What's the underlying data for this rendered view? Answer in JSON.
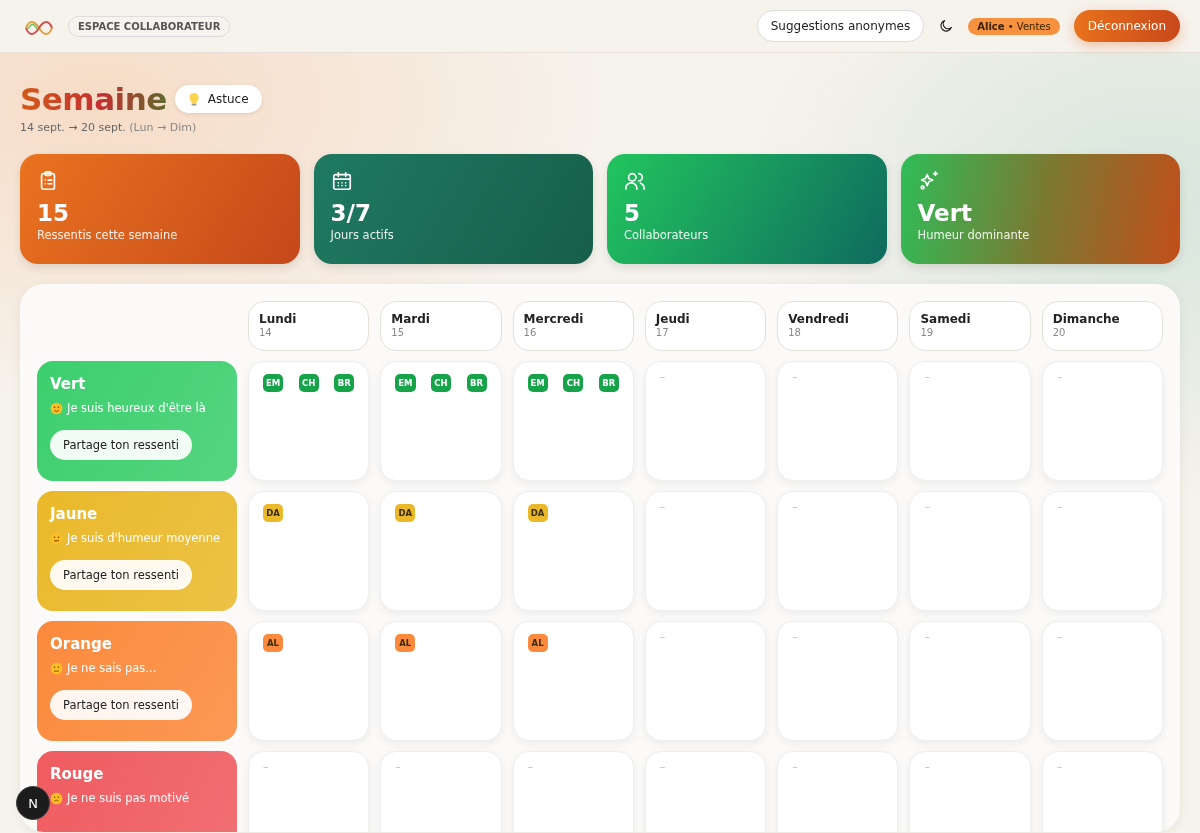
{
  "header": {
    "badge": "ESPACE COLLABORATEUR",
    "suggestions_button": "Suggestions anonymes",
    "user": {
      "name": "Alice",
      "separator": "•",
      "team": "Ventes"
    },
    "logout_button": "Déconnexion"
  },
  "page": {
    "title": "Semaine",
    "tip_button": "Astuce",
    "range": "14 sept. → 20 sept.",
    "range_hint": "(Lun → Dim)"
  },
  "stats": [
    {
      "kind": "clipboard",
      "value": "15",
      "label": "Ressentis cette semaine"
    },
    {
      "kind": "calendar",
      "value": "3/7",
      "label": "Jours actifs"
    },
    {
      "kind": "users",
      "value": "5",
      "label": "Collaborateurs"
    },
    {
      "kind": "sparkles",
      "value": "Vert",
      "label": "Humeur dominante"
    }
  ],
  "days": [
    {
      "name": "Lundi",
      "date": "14"
    },
    {
      "name": "Mardi",
      "date": "15"
    },
    {
      "name": "Mercredi",
      "date": "16"
    },
    {
      "name": "Jeudi",
      "date": "17"
    },
    {
      "name": "Vendredi",
      "date": "18"
    },
    {
      "name": "Samedi",
      "date": "19"
    },
    {
      "name": "Dimanche",
      "date": "20"
    }
  ],
  "moods": [
    {
      "name": "Vert",
      "color": "#3ccf6e",
      "kind": "happy",
      "text": "Je suis heureux d'être là",
      "button": "Partage ton ressenti",
      "cells": [
        {
          "kind": "badges",
          "badges": [
            "EM",
            "CH",
            "BR"
          ]
        },
        {
          "kind": "badges",
          "badges": [
            "EM",
            "CH",
            "BR"
          ]
        },
        {
          "kind": "badges",
          "badges": [
            "EM",
            "CH",
            "BR"
          ]
        },
        {
          "kind": "empty",
          "text": "–"
        },
        {
          "kind": "empty",
          "text": "–"
        },
        {
          "kind": "empty",
          "text": "–"
        },
        {
          "kind": "empty",
          "text": "–"
        }
      ]
    },
    {
      "name": "Jaune",
      "color": "#eab92a",
      "kind": "neutral",
      "text": "Je suis d'humeur moyenne",
      "button": "Partage ton ressenti",
      "cells": [
        {
          "kind": "badges",
          "badges": [
            "DA"
          ]
        },
        {
          "kind": "badges",
          "badges": [
            "DA"
          ]
        },
        {
          "kind": "badges",
          "badges": [
            "DA"
          ]
        },
        {
          "kind": "empty",
          "text": "–"
        },
        {
          "kind": "empty",
          "text": "–"
        },
        {
          "kind": "empty",
          "text": "–"
        },
        {
          "kind": "empty",
          "text": "–"
        }
      ]
    },
    {
      "name": "Orange",
      "color": "#fb8a3c",
      "kind": "unsure",
      "text": "Je ne sais pas...",
      "button": "Partage ton ressenti",
      "cells": [
        {
          "kind": "badges",
          "badges": [
            "AL"
          ]
        },
        {
          "kind": "badges",
          "badges": [
            "AL"
          ]
        },
        {
          "kind": "badges",
          "badges": [
            "AL"
          ]
        },
        {
          "kind": "empty",
          "text": "–"
        },
        {
          "kind": "empty",
          "text": "–"
        },
        {
          "kind": "empty",
          "text": "–"
        },
        {
          "kind": "empty",
          "text": "–"
        }
      ]
    },
    {
      "name": "Rouge",
      "color": "#ef5b60",
      "kind": "sad",
      "text": "Je ne suis pas motivé",
      "cells": [
        {
          "kind": "empty",
          "text": "–"
        },
        {
          "kind": "empty",
          "text": "–"
        },
        {
          "kind": "empty",
          "text": "–"
        },
        {
          "kind": "empty",
          "text": "–"
        },
        {
          "kind": "empty",
          "text": "–"
        },
        {
          "kind": "empty",
          "text": "–"
        },
        {
          "kind": "empty",
          "text": "–"
        }
      ]
    }
  ],
  "dev_badge": "N"
}
